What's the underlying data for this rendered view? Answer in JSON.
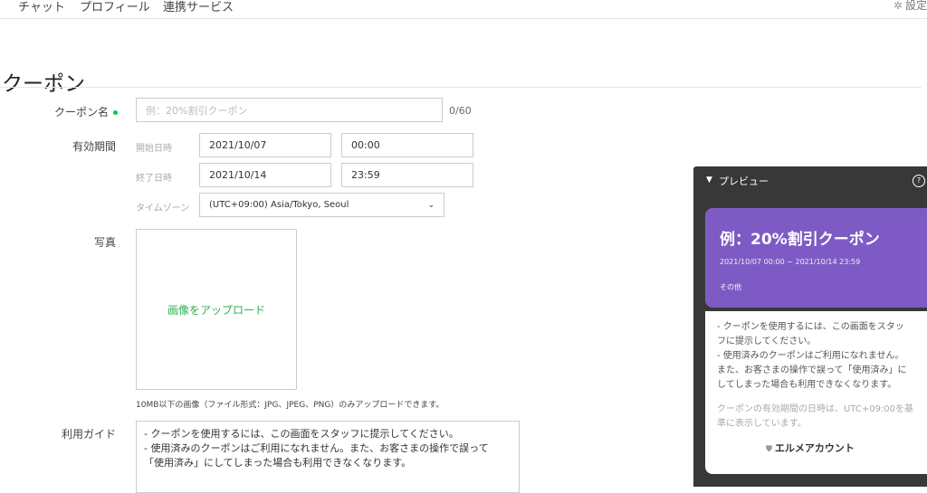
{
  "nav": {
    "tabs": [
      "チャット",
      "プロフィール",
      "連携サービス"
    ],
    "settings_label": "設定",
    "settings_icon": "gear-icon"
  },
  "page": {
    "title": "クーポン"
  },
  "form": {
    "coupon_name": {
      "label": "クーポン名",
      "placeholder": "例：20%割引クーポン",
      "counter": "0/60"
    },
    "validity": {
      "label": "有効期間",
      "start_label": "開始日時",
      "start_date": "2021/10/07",
      "start_time": "00:00",
      "end_label": "終了日時",
      "end_date": "2021/10/14",
      "end_time": "23:59",
      "tz_label": "タイムゾーン",
      "tz_value": "(UTC+09:00) Asia/Tokyo, Seoul"
    },
    "photo": {
      "label": "写真",
      "upload_text": "画像をアップロード",
      "note": "10MB以下の画像（ファイル形式：JPG、JPEG、PNG）のみアップロードできます。"
    },
    "guide": {
      "label": "利用ガイド",
      "lines": [
        "- クーポンを使用するには、この画面をスタッフに提示してください。",
        "- 使用済みのクーポンはご利用になれません。また、お客さまの操作で誤って",
        "「使用済み」にしてしまった場合も利用できなくなります。"
      ]
    }
  },
  "preview": {
    "title": "プレビュー",
    "help_icon": "help-icon",
    "card_title": "例：20%割引クーポン",
    "card_dates": "2021/10/07 00:00 ~ 2021/10/14 23:59",
    "card_category": "その他",
    "card_color": "#7e5bc4",
    "guide_lines": [
      "- クーポンを使用するには、この画面をスタッ",
      "フに提示してください。",
      "- 使用済みのクーポンはご利用になれません。",
      "また、お客さまの操作で誤って「使用済み」に",
      "してしまった場合も利用できなくなります。"
    ],
    "note_lines": [
      "クーポンの有効期間の日時は、UTC+09:00を基",
      "準に表示しています。"
    ],
    "account_name": "エルメアカウント"
  }
}
